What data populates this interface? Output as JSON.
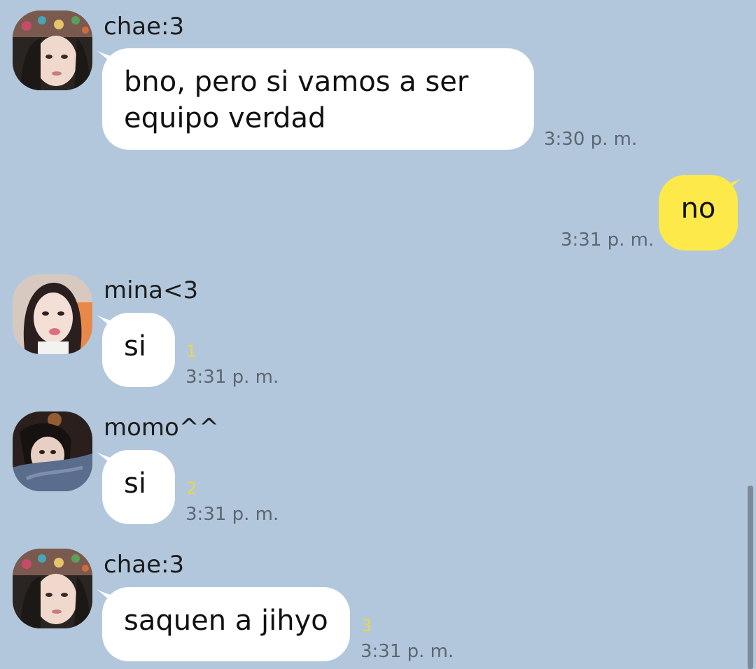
{
  "colors": {
    "background": "#b2c7dc",
    "incoming_bubble": "#ffffff",
    "outgoing_bubble": "#fee94a",
    "unread_count": "#e9d64a",
    "timestamp": "#5d6670"
  },
  "messages": [
    {
      "sender": "chae:3",
      "text": "bno, pero si vamos a ser\nequipo verdad",
      "time": "3:30 p. m.",
      "unread": ""
    },
    {
      "sender": "",
      "text": "no",
      "time": "3:31 p. m.",
      "unread": ""
    },
    {
      "sender": "mina<3",
      "text": "si",
      "time": "3:31 p. m.",
      "unread": "1"
    },
    {
      "sender": "momo^^",
      "text": "si",
      "time": "3:31 p. m.",
      "unread": "2"
    },
    {
      "sender": "chae:3",
      "text": "saquen a jihyo",
      "time": "3:31 p. m.",
      "unread": "3"
    }
  ]
}
